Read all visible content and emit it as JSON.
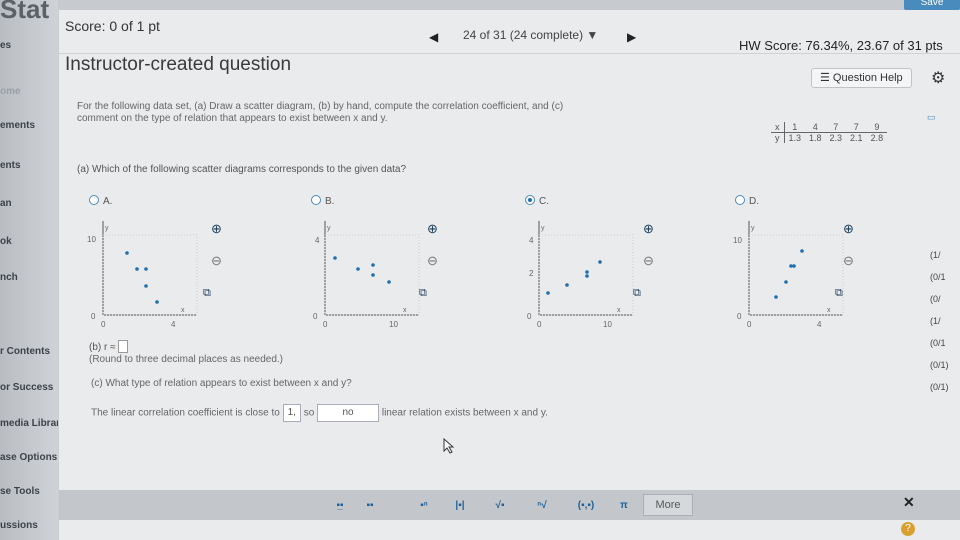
{
  "app_title": "Stat",
  "save_label": "Save",
  "sidebar": {
    "items": [
      {
        "label": "es"
      },
      {
        "label": "ome"
      },
      {
        "label": "ements"
      },
      {
        "label": "ents"
      },
      {
        "label": "an"
      },
      {
        "label": "ok"
      },
      {
        "label": "nch"
      },
      {
        "label": "r Contents"
      },
      {
        "label": "or Success"
      },
      {
        "label": "media Library"
      },
      {
        "label": "ase Options"
      },
      {
        "label": "se Tools"
      },
      {
        "label": "ussions"
      }
    ]
  },
  "header": {
    "score": "Score: 0 of 1 pt",
    "progress": "24 of 31 (24 complete) ▼",
    "hw_score": "HW Score: 76.34%, 23.67 of 31 pts",
    "question_title": "Instructor-created question",
    "help_label": "Question Help"
  },
  "question": {
    "instructions": "For the following data set, (a) Draw a scatter diagram, (b) by hand, compute the correlation coefficient, and (c) comment on the type of relation that appears to exist between x and y.",
    "table": {
      "x_label": "x",
      "y_label": "y",
      "x": [
        "1",
        "4",
        "7",
        "7",
        "9"
      ],
      "y": [
        "1.3",
        "1.8",
        "2.3",
        "2.1",
        "2.8"
      ]
    },
    "part_a": "(a) Which of the following scatter diagrams corresponds to the given data?",
    "options": [
      {
        "label": "A.",
        "selected": false,
        "y_tick": "10",
        "x_tick": "4",
        "origin": "0"
      },
      {
        "label": "B.",
        "selected": false,
        "y_tick": "4",
        "x_tick": "10",
        "origin": "0"
      },
      {
        "label": "C.",
        "selected": true,
        "y_tick": "4",
        "y_tick2": "2",
        "x_tick": "10",
        "origin": "0"
      },
      {
        "label": "D.",
        "selected": false,
        "y_tick": "10",
        "x_tick": "4",
        "origin": "0"
      }
    ],
    "part_b_prefix": "(b) r ≈",
    "round_note": "(Round to three decimal places as needed.)",
    "part_c": "(c) What type of relation appears to exist between x and y?",
    "answer_prefix": "The linear correlation coefficient is close to",
    "answer_value": "1,",
    "answer_so": "so",
    "answer_choice": "no",
    "answer_suffix": "linear relation exists between x and y."
  },
  "right_edge": [
    "(1/",
    "(0/1",
    "(0/",
    "(1/",
    "(0/1",
    "(0/1)",
    "(0/1)"
  ],
  "toolbar": {
    "more_label": "More",
    "pi": "π"
  }
}
